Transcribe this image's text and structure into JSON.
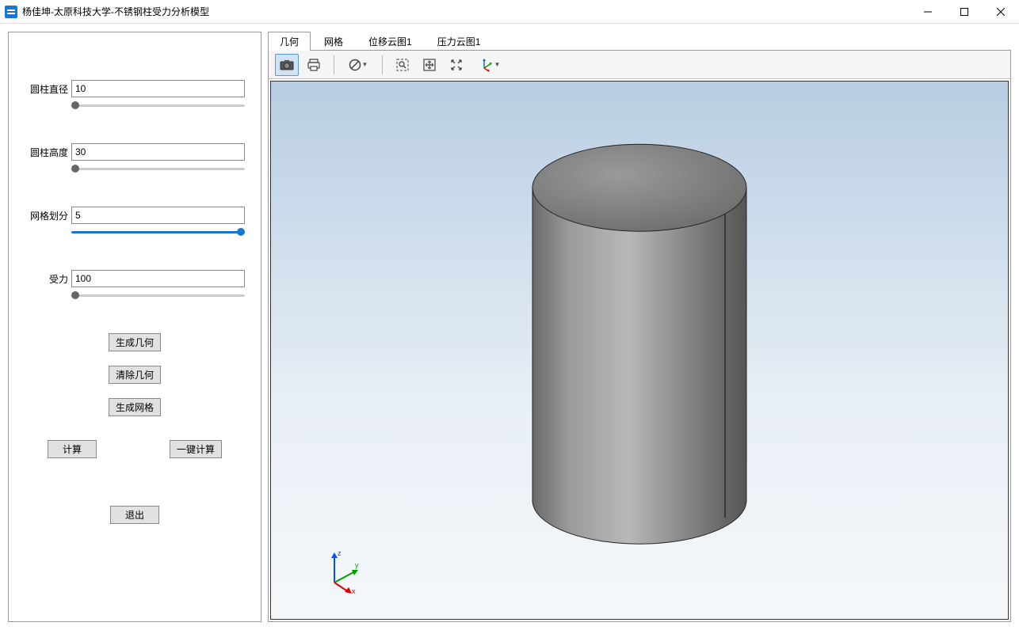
{
  "window": {
    "title": "杨佳坤-太原科技大学-不锈钢柱受力分析模型"
  },
  "params": {
    "diameter": {
      "label": "圆柱直径",
      "value": "10"
    },
    "height": {
      "label": "圆柱高度",
      "value": "30"
    },
    "mesh": {
      "label": "网格划分",
      "value": "5"
    },
    "force": {
      "label": "受力",
      "value": "100"
    }
  },
  "buttons": {
    "gen_geometry": "生成几何",
    "clear_geometry": "清除几何",
    "gen_mesh": "生成网格",
    "compute": "计算",
    "one_click": "一键计算",
    "exit": "退出"
  },
  "tabs": [
    {
      "label": "几何",
      "active": true
    },
    {
      "label": "网格",
      "active": false
    },
    {
      "label": "位移云图1",
      "active": false
    },
    {
      "label": "压力云图1",
      "active": false
    }
  ],
  "axis": {
    "x": "x",
    "y": "y",
    "z": "z"
  }
}
